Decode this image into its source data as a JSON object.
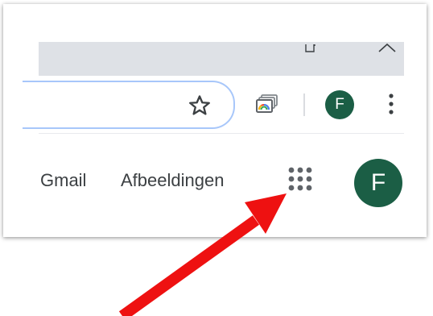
{
  "browser": {
    "profile_initial": "F",
    "profile_color": "#1b5e45",
    "omnibox_focus_color": "#a8c7fa",
    "titlebar_color": "#dee1e6"
  },
  "icons": {
    "restore": "window-restore-icon",
    "chevron": "chevron-up-icon",
    "bookmark": "star-icon",
    "cast": "cast-icon",
    "menu": "kebab-menu-icon",
    "apps": "google-apps-icon"
  },
  "google_bar": {
    "gmail_label": "Gmail",
    "images_label": "Afbeeldingen",
    "profile_initial": "F"
  },
  "annotation": {
    "arrow_color": "#ee1111"
  }
}
